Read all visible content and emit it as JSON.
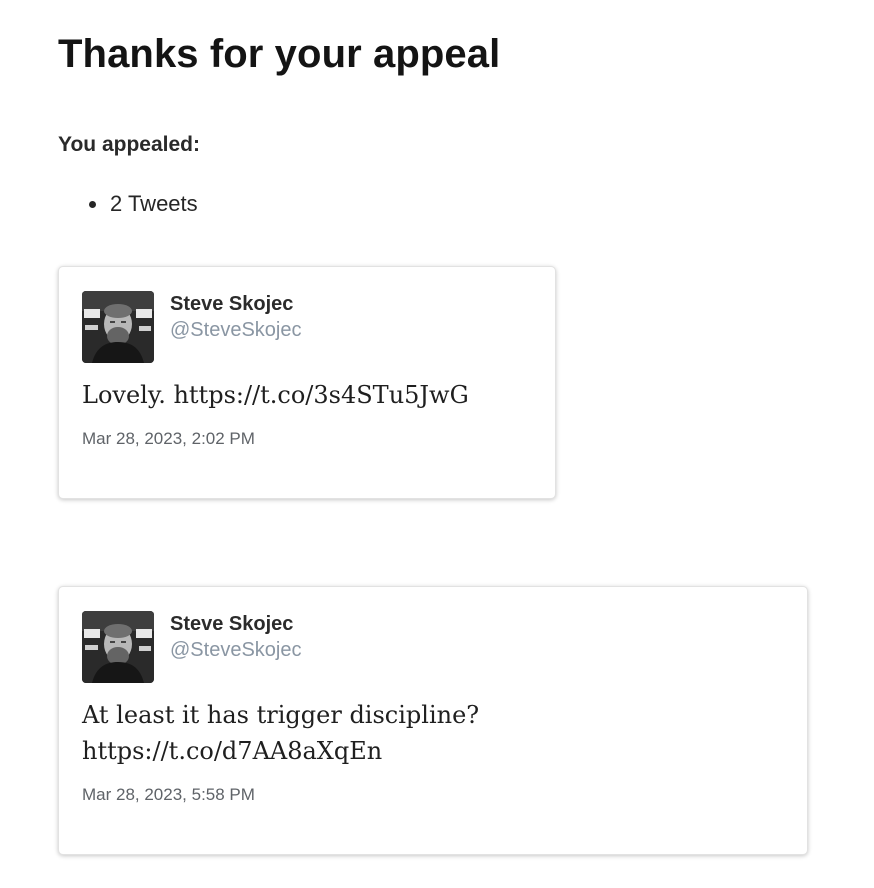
{
  "page": {
    "title": "Thanks for your appeal",
    "subtitle": "You appealed:"
  },
  "summary": {
    "items": [
      "2 Tweets"
    ]
  },
  "tweets": [
    {
      "author_name": "Steve Skojec",
      "author_handle": "@SteveSkojec",
      "text": "Lovely. https://t.co/3s4STu5JwG",
      "timestamp": "Mar 28, 2023, 2:02 PM",
      "avatar_icon": "profile-photo-avatar"
    },
    {
      "author_name": "Steve Skojec",
      "author_handle": "@SteveSkojec",
      "text": "At least it has trigger discipline?\nhttps://t.co/d7AA8aXqEn",
      "timestamp": "Mar 28, 2023, 5:58 PM",
      "avatar_icon": "profile-photo-avatar"
    }
  ],
  "colors": {
    "heading": "#141414",
    "body_text": "#262626",
    "handle": "#8a96a3",
    "timestamp": "#5f6368",
    "card_border": "#e2e2e2"
  }
}
